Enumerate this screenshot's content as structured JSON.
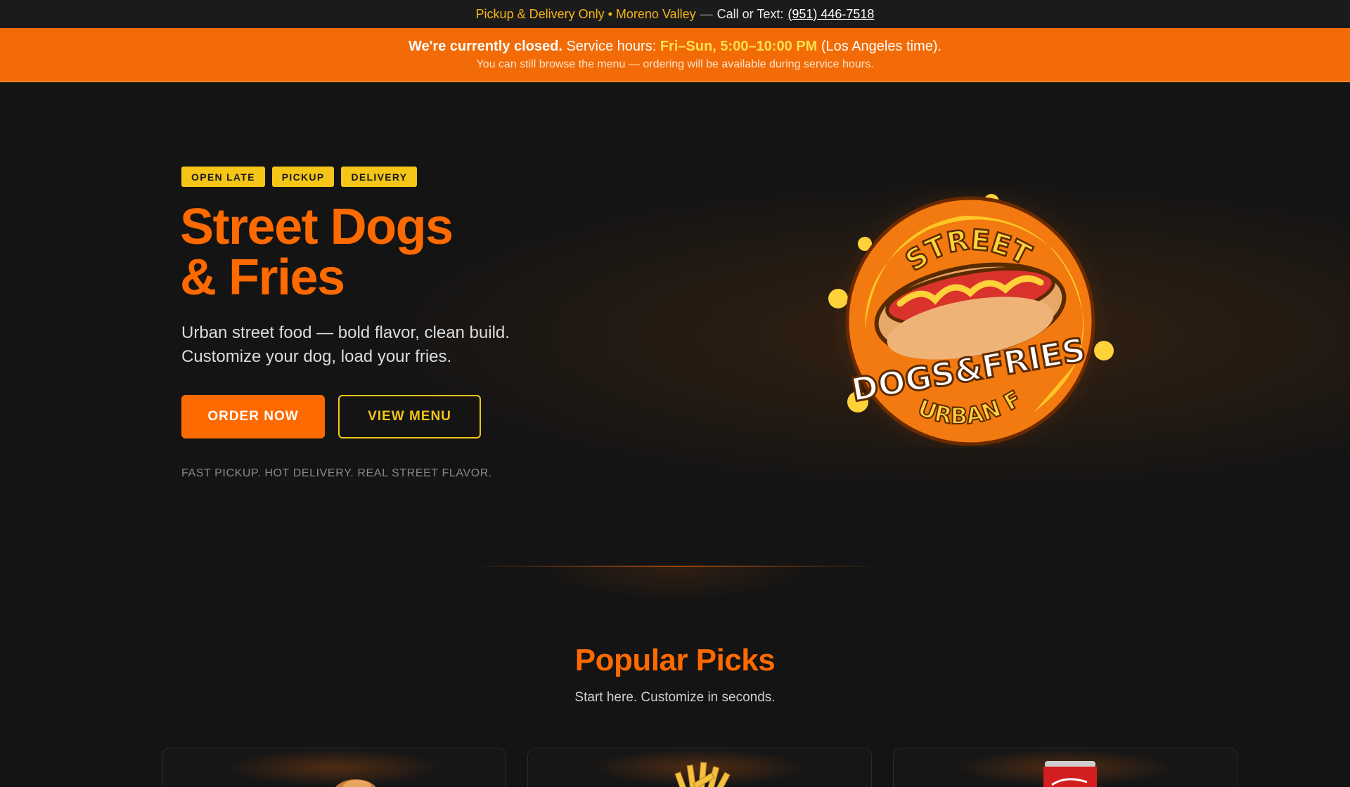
{
  "topbar": {
    "service": "Pickup & Delivery Only • Moreno Valley",
    "separator": "—",
    "call_label": "Call or Text:",
    "phone": "(951) 446-7518"
  },
  "banner": {
    "closed": "We're currently closed.",
    "hours_label": "Service hours:",
    "hours": "Fri–Sun, 5:00–10:00 PM",
    "timezone": "(Los Angeles time).",
    "note": "You can still browse the menu — ordering will be available during service hours."
  },
  "hero": {
    "badges": [
      "OPEN LATE",
      "PICKUP",
      "DELIVERY"
    ],
    "title_line1": "Street Dogs",
    "title_line2": "& Fries",
    "sub_line1": "Urban street food — bold flavor, clean build.",
    "sub_line2": "Customize your dog, load your fries.",
    "order_button": "ORDER NOW",
    "menu_button": "VIEW MENU",
    "tagline": "FAST PICKUP. HOT DELIVERY. REAL STREET FLAVOR."
  },
  "logo": {
    "top": "STREET",
    "middle": "DOGS&FRIES",
    "bottom": "URBAN FOOD"
  },
  "popular": {
    "title": "Popular Picks",
    "subtitle": "Start here. Customize in seconds.",
    "cards": [
      {
        "icon": "hotdog-icon"
      },
      {
        "icon": "fries-icon"
      },
      {
        "icon": "soda-can-icon"
      }
    ]
  },
  "colors": {
    "accent": "#ff6a00",
    "yellow": "#f5c517",
    "background": "#141414",
    "banner": "#f26b06"
  }
}
